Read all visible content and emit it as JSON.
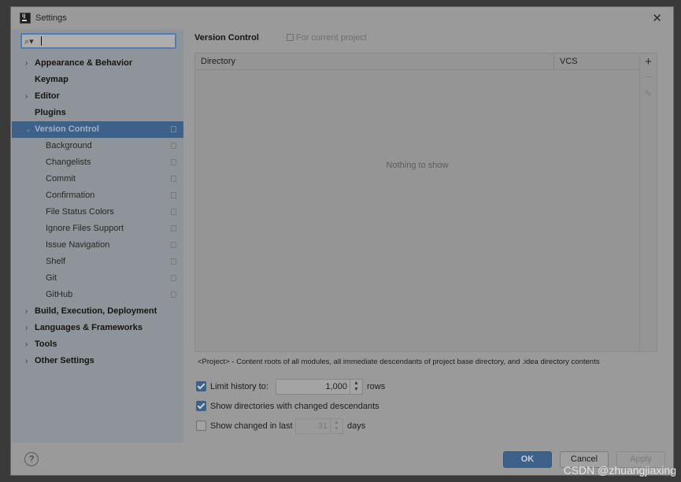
{
  "window": {
    "title": "Settings",
    "icon": "intellij-app-icon",
    "close_icon": "close-icon"
  },
  "search": {
    "value": "",
    "icon": "search-icon"
  },
  "sidebar": {
    "items": [
      {
        "label": "Appearance & Behavior",
        "level": "top",
        "expandable": true
      },
      {
        "label": "Keymap",
        "level": "top",
        "expandable": false
      },
      {
        "label": "Editor",
        "level": "top",
        "expandable": true
      },
      {
        "label": "Plugins",
        "level": "top",
        "expandable": false
      },
      {
        "label": "Version Control",
        "level": "top",
        "expandable": true,
        "expanded": true,
        "selected": true,
        "project_scoped": true
      },
      {
        "label": "Background",
        "level": "child",
        "project_scoped": true
      },
      {
        "label": "Changelists",
        "level": "child",
        "project_scoped": true
      },
      {
        "label": "Commit",
        "level": "child",
        "project_scoped": true
      },
      {
        "label": "Confirmation",
        "level": "child",
        "project_scoped": true
      },
      {
        "label": "File Status Colors",
        "level": "child",
        "project_scoped": true
      },
      {
        "label": "Ignore Files Support",
        "level": "child",
        "project_scoped": true
      },
      {
        "label": "Issue Navigation",
        "level": "child",
        "project_scoped": true
      },
      {
        "label": "Shelf",
        "level": "child",
        "project_scoped": true
      },
      {
        "label": "Git",
        "level": "child",
        "project_scoped": true
      },
      {
        "label": "GitHub",
        "level": "child",
        "project_scoped": true
      },
      {
        "label": "Build, Execution, Deployment",
        "level": "top",
        "expandable": true
      },
      {
        "label": "Languages & Frameworks",
        "level": "top",
        "expandable": true
      },
      {
        "label": "Tools",
        "level": "top",
        "expandable": true
      },
      {
        "label": "Other Settings",
        "level": "top",
        "expandable": true
      }
    ]
  },
  "content": {
    "title": "Version Control",
    "scope_label": "For current project",
    "table": {
      "columns": [
        "Directory",
        "VCS"
      ],
      "rows": [],
      "empty_text": "Nothing to show"
    },
    "toolbar": {
      "add": "+",
      "remove": "−",
      "edit": "✎"
    },
    "note": "<Project> - Content roots of all modules, all immediate descendants of project base directory, and .idea directory contents",
    "limit_history": {
      "label": "Limit history to:",
      "checked": true,
      "value": "1,000",
      "unit": "rows"
    },
    "show_descendants": {
      "label": "Show directories with changed descendants",
      "checked": true
    },
    "show_changed": {
      "label": "Show changed in last",
      "checked": false,
      "value": "31",
      "unit": "days"
    }
  },
  "footer": {
    "help": "?",
    "ok": "OK",
    "cancel": "Cancel",
    "apply": "Apply"
  },
  "watermark": "CSDN @zhuangjiaxing"
}
